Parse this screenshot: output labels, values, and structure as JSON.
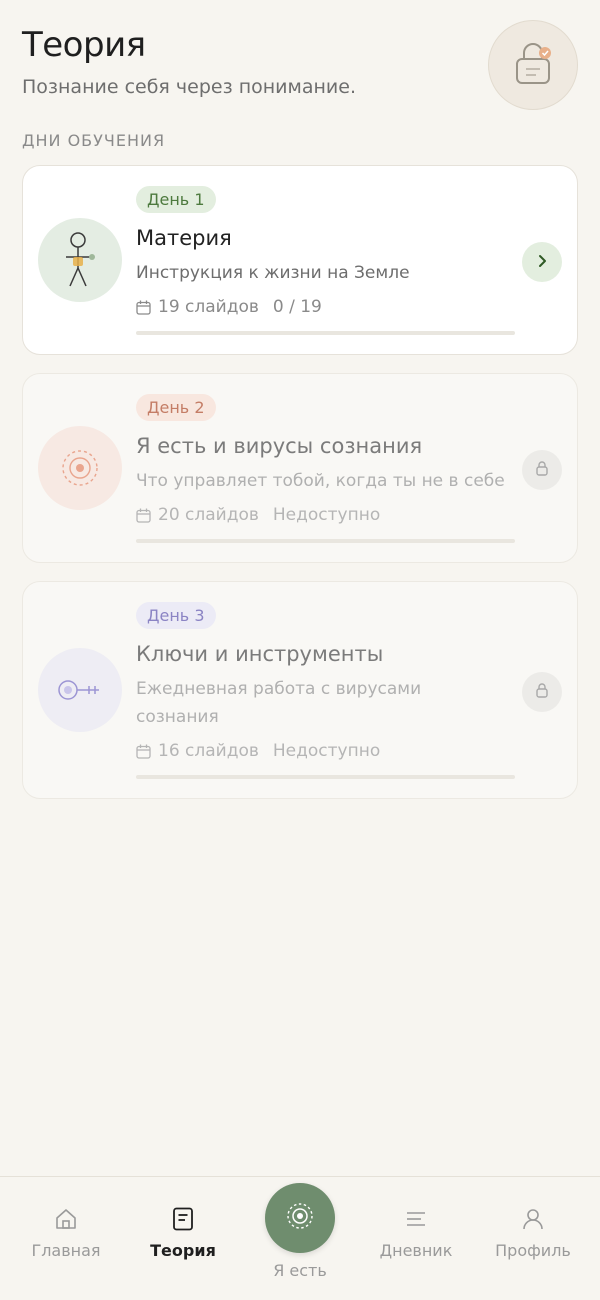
{
  "header": {
    "title": "Теория",
    "subtitle": "Познание себя через понимание.",
    "badge_icon": "lock-check-icon"
  },
  "section": {
    "label": "ДНИ ОБУЧЕНИЯ"
  },
  "days": [
    {
      "day_label": "День 1",
      "title": "Материя",
      "description": "Инструкция к жизни на Земле",
      "slides": "19 слайдов",
      "status": "0 / 19",
      "progress": 0,
      "locked": false,
      "icon": "stick-figure-icon",
      "action_icon": "chevron-right-icon",
      "accent": "#4d7a3e"
    },
    {
      "day_label": "День 2",
      "title": "Я есть и вирусы сознания",
      "description": "Что управляет тобой, когда ты не в себе",
      "slides": "20 слайдов",
      "status": "Недоступно",
      "progress": 0,
      "locked": true,
      "icon": "target-circles-icon",
      "action_icon": "lock-icon",
      "accent": "#c47d66"
    },
    {
      "day_label": "День 3",
      "title": "Ключи и инструменты",
      "description": "Ежедневная работа с вирусами сознания",
      "slides": "16 слайдов",
      "status": "Недоступно",
      "progress": 0,
      "locked": true,
      "icon": "key-icon",
      "action_icon": "lock-icon",
      "accent": "#8b84c4"
    }
  ],
  "nav": {
    "home": "Главная",
    "theory": "Теория",
    "center": "Я есть",
    "journal": "Дневник",
    "profile": "Профиль",
    "active": "theory",
    "center_color": "#6f8d6e"
  }
}
